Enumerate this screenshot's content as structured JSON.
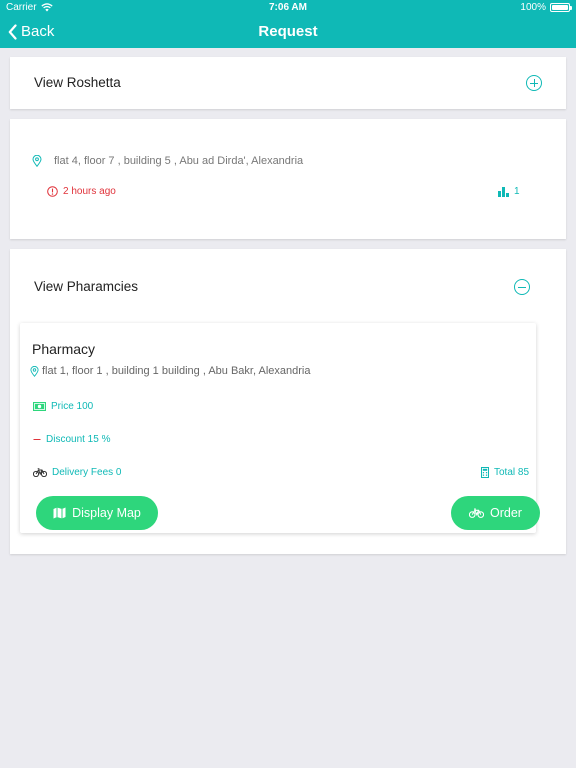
{
  "status_bar": {
    "carrier": "Carrier",
    "time": "7:06 AM",
    "battery": "100%"
  },
  "nav": {
    "back_label": "Back",
    "title": "Request"
  },
  "roshetta": {
    "title": "View Roshetta",
    "icon": "plus-circle-icon"
  },
  "request": {
    "address": "flat 4, floor 7 , building 5 , Abu ad Dirda', Alexandria",
    "time_ago": "2 hours ago",
    "count": "1"
  },
  "pharmacies": {
    "title": "View Pharamcies",
    "icon": "minus-circle-icon",
    "items": [
      {
        "name": "Pharmacy",
        "address": "flat 1, floor 1 , building 1 building , Abu Bakr, Alexandria",
        "price": "Price 100",
        "discount": "Discount 15 %",
        "delivery_fees": "Delivery Fees 0",
        "total": "Total 85",
        "display_map_label": "Display Map",
        "order_label": "Order"
      }
    ]
  },
  "colors": {
    "accent": "#0fb9b6",
    "button_green": "#2ed67c",
    "alert_red": "#e0333b",
    "background": "#ebebf0"
  }
}
